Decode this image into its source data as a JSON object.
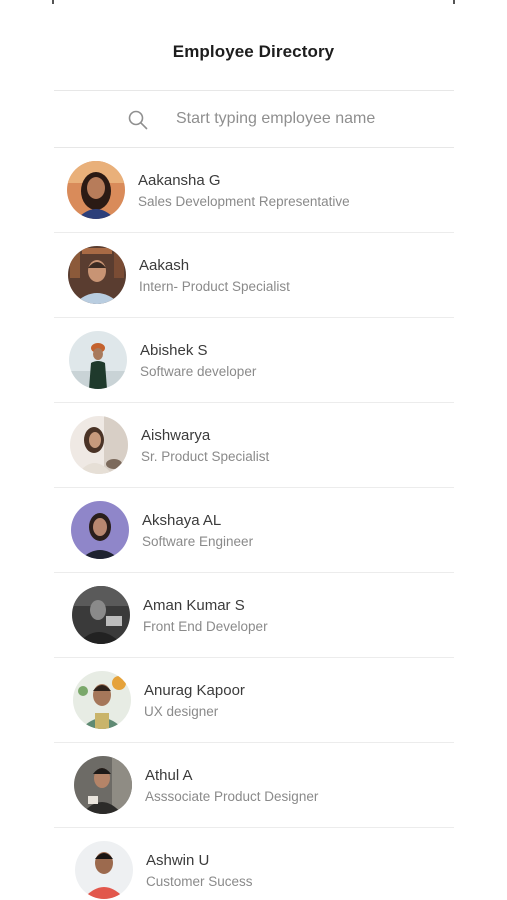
{
  "header": {
    "title": "Employee Directory"
  },
  "search": {
    "placeholder": "Start typing employee name",
    "value": ""
  },
  "employees": [
    {
      "name": "Aakansha G",
      "role": "Sales Development Representative"
    },
    {
      "name": "Aakash",
      "role": "Intern- Product Specialist"
    },
    {
      "name": "Abishek S",
      "role": "Software developer"
    },
    {
      "name": "Aishwarya",
      "role": "Sr. Product Specialist"
    },
    {
      "name": "Akshaya AL",
      "role": "Software Engineer"
    },
    {
      "name": "Aman Kumar S",
      "role": "Front End Developer"
    },
    {
      "name": "Anurag Kapoor",
      "role": "UX designer"
    },
    {
      "name": "Athul A",
      "role": "Asssociate Product Designer"
    },
    {
      "name": "Ashwin U",
      "role": "Customer Sucess"
    }
  ],
  "colors": {
    "divider": "#e7e7e7",
    "name": "#3b3b3b",
    "role": "#8a8a8a",
    "title": "#1d1d1d"
  }
}
